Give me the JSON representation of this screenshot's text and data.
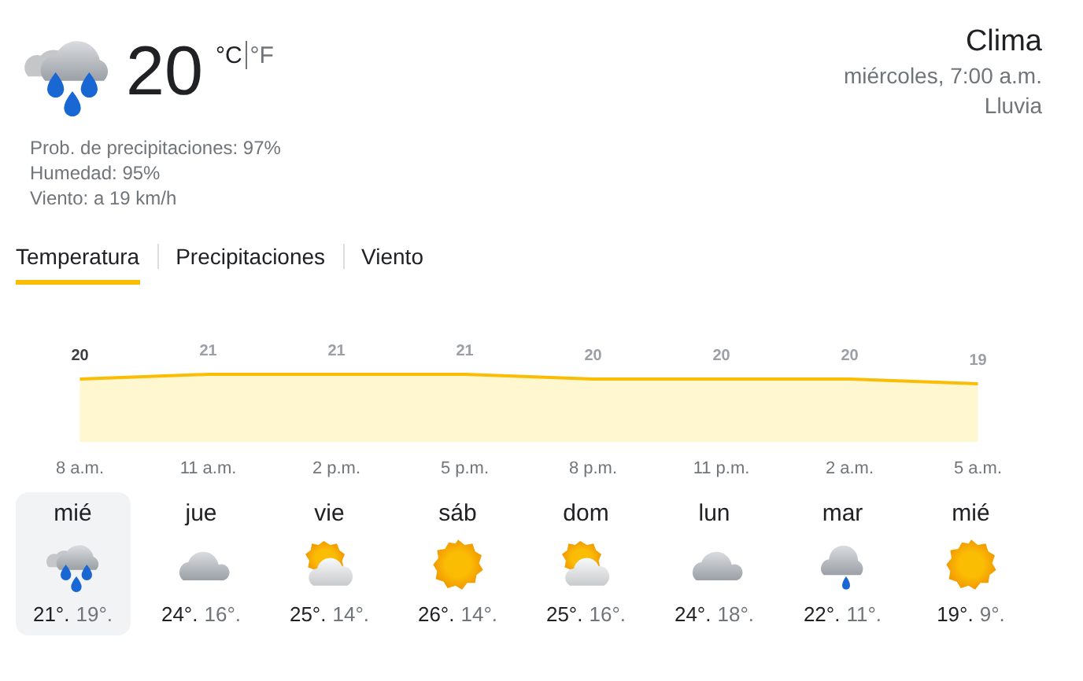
{
  "current": {
    "kind": "rain",
    "temperature": "20",
    "units": [
      {
        "label": "°C",
        "selected": true
      },
      {
        "label": "°F",
        "selected": false
      }
    ],
    "details": [
      "Prob. de precipitaciones: 97%",
      "Humedad: 95%",
      "Viento: a 19 km/h"
    ]
  },
  "header": {
    "title": "Clima",
    "datetime": "miércoles, 7:00 a.m.",
    "condition": "Lluvia"
  },
  "tabs": [
    {
      "label": "Temperatura",
      "selected": true
    },
    {
      "label": "Precipitaciones",
      "selected": false
    },
    {
      "label": "Viento",
      "selected": false
    }
  ],
  "chart": {
    "chart_data": {
      "type": "area",
      "categories": [
        "8 a.m.",
        "11 a.m.",
        "2 p.m.",
        "5 p.m.",
        "8 p.m.",
        "11 p.m.",
        "2 a.m.",
        "5 a.m."
      ],
      "series": [
        {
          "color": "#fbbc04",
          "values": [
            20,
            21,
            21,
            21,
            20,
            20,
            20,
            19
          ]
        }
      ],
      "data_labels": true
    }
  },
  "days": [
    {
      "day": "mié",
      "kind": "rain",
      "high": "21°.",
      "low": "19°.",
      "selected": true
    },
    {
      "day": "jue",
      "kind": "cloudy",
      "high": "24°.",
      "low": "16°.",
      "selected": false
    },
    {
      "day": "vie",
      "kind": "partly-sunny",
      "high": "25°.",
      "low": "14°.",
      "selected": false
    },
    {
      "day": "sáb",
      "kind": "sunny",
      "high": "26°.",
      "low": "14°.",
      "selected": false
    },
    {
      "day": "dom",
      "kind": "partly-sunny",
      "high": "25°.",
      "low": "16°.",
      "selected": false
    },
    {
      "day": "lun",
      "kind": "cloudy",
      "high": "24°.",
      "low": "18°.",
      "selected": false
    },
    {
      "day": "mar",
      "kind": "light-rain",
      "high": "22°.",
      "low": "11°.",
      "selected": false
    },
    {
      "day": "mié",
      "kind": "sunny",
      "high": "19°.",
      "low": "9°.",
      "selected": false
    }
  ]
}
